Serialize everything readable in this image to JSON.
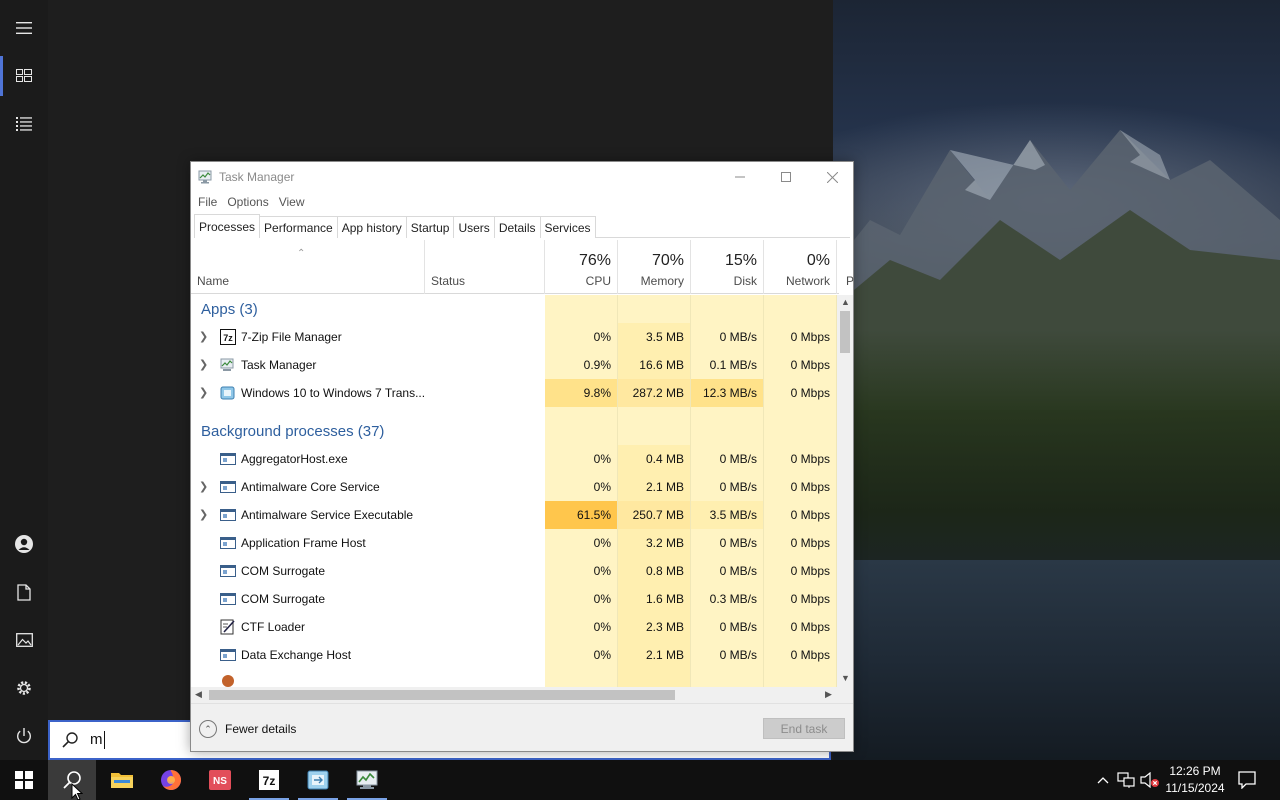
{
  "start_menu": {
    "rail": {
      "hamburger_icon": "hamburger-icon",
      "tiles_icon": "tiles-icon",
      "list_icon": "all-apps-list-icon",
      "user_icon": "user-icon",
      "documents_icon": "document-icon",
      "pictures_icon": "pictures-icon",
      "settings_icon": "gear-icon",
      "power_icon": "power-icon"
    },
    "search": {
      "value": "m",
      "icon": "search-icon"
    }
  },
  "task_manager": {
    "title": "Task Manager",
    "menu": [
      "File",
      "Options",
      "View"
    ],
    "tabs": [
      "Processes",
      "Performance",
      "App history",
      "Startup",
      "Users",
      "Details",
      "Services"
    ],
    "active_tab": "Processes",
    "columns": {
      "name": "Name",
      "status": "Status",
      "cpu_pct": "76%",
      "cpu_label": "CPU",
      "memory_pct": "70%",
      "memory_label": "Memory",
      "disk_pct": "15%",
      "disk_label": "Disk",
      "network_pct": "0%",
      "network_label": "Network",
      "power_label": "P"
    },
    "groups": {
      "apps_title": "Apps (3)",
      "background_title": "Background processes (37)"
    },
    "apps": [
      {
        "name": "7-Zip File Manager",
        "cpu": "0%",
        "memory": "3.5 MB",
        "disk": "0 MB/s",
        "network": "0 Mbps",
        "icon": "7zip-icon",
        "expandable": "yes"
      },
      {
        "name": "Task Manager",
        "cpu": "0.9%",
        "memory": "16.6 MB",
        "disk": "0.1 MB/s",
        "network": "0 Mbps",
        "icon": "task-manager-icon",
        "expandable": "yes"
      },
      {
        "name": "Windows 10 to Windows 7 Trans...",
        "cpu": "9.8%",
        "memory": "287.2 MB",
        "disk": "12.3 MB/s",
        "network": "0 Mbps",
        "icon": "transfer-app-icon",
        "expandable": "yes"
      }
    ],
    "background": [
      {
        "name": "AggregatorHost.exe",
        "cpu": "0%",
        "memory": "0.4 MB",
        "disk": "0 MB/s",
        "network": "0 Mbps",
        "icon": "process-window-icon",
        "expandable": "no"
      },
      {
        "name": "Antimalware Core Service",
        "cpu": "0%",
        "memory": "2.1 MB",
        "disk": "0 MB/s",
        "network": "0 Mbps",
        "icon": "process-window-icon",
        "expandable": "yes"
      },
      {
        "name": "Antimalware Service Executable",
        "cpu": "61.5%",
        "memory": "250.7 MB",
        "disk": "3.5 MB/s",
        "network": "0 Mbps",
        "icon": "process-window-icon",
        "expandable": "yes"
      },
      {
        "name": "Application Frame Host",
        "cpu": "0%",
        "memory": "3.2 MB",
        "disk": "0 MB/s",
        "network": "0 Mbps",
        "icon": "process-window-icon",
        "expandable": "no"
      },
      {
        "name": "COM Surrogate",
        "cpu": "0%",
        "memory": "0.8 MB",
        "disk": "0 MB/s",
        "network": "0 Mbps",
        "icon": "process-window-icon",
        "expandable": "no"
      },
      {
        "name": "COM Surrogate",
        "cpu": "0%",
        "memory": "1.6 MB",
        "disk": "0.3 MB/s",
        "network": "0 Mbps",
        "icon": "process-window-icon",
        "expandable": "no"
      },
      {
        "name": "CTF Loader",
        "cpu": "0%",
        "memory": "2.3 MB",
        "disk": "0 MB/s",
        "network": "0 Mbps",
        "icon": "ctf-loader-icon",
        "expandable": "no"
      },
      {
        "name": "Data Exchange Host",
        "cpu": "0%",
        "memory": "2.1 MB",
        "disk": "0 MB/s",
        "network": "0 Mbps",
        "icon": "process-window-icon",
        "expandable": "no"
      }
    ],
    "footer": {
      "fewer_details": "Fewer details",
      "end_task": "End task"
    }
  },
  "taskbar": {
    "items": [
      "start-icon",
      "search-icon",
      "file-explorer-icon",
      "firefox-icon",
      "visual-studio-icon",
      "7zip-icon",
      "transfer-app-icon",
      "task-manager-icon"
    ],
    "clock_time": "12:26 PM",
    "clock_date": "11/15/2024",
    "tray_icons": [
      "chevron-up-icon",
      "network-icon",
      "volume-muted-icon",
      "notification-icon"
    ]
  },
  "colors": {
    "accent": "#4f74d6",
    "group_title": "#2e5f9e",
    "heat_low": "#fff4c4",
    "heat_high": "#ffc64c"
  }
}
